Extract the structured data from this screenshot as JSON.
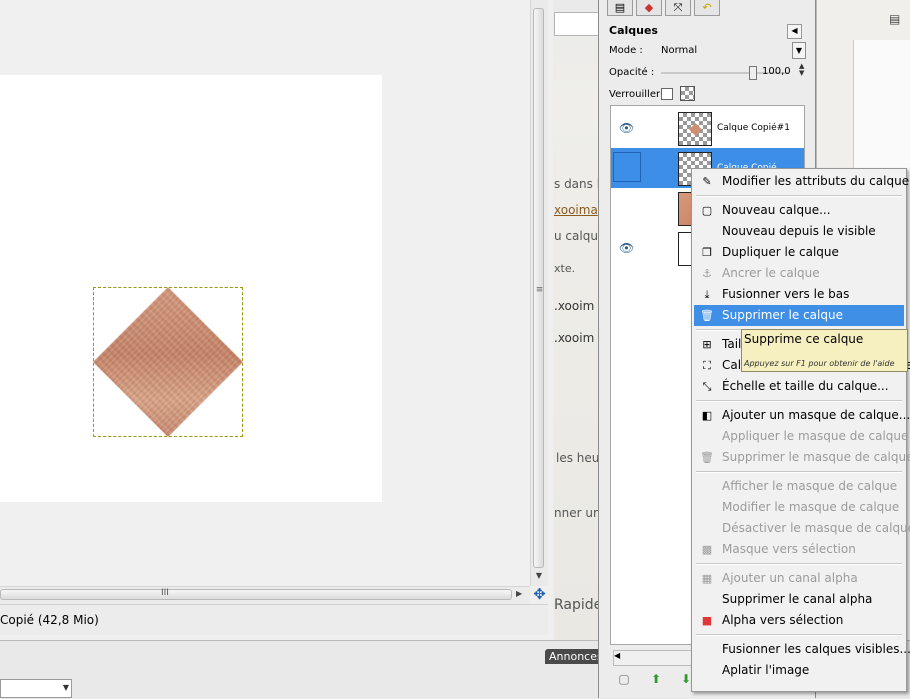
{
  "background_page": {
    "snippets": [
      "s dans l",
      "xooima",
      "u calque",
      "xte.",
      ".xooim",
      ".xooim",
      "les heu",
      "nner ur",
      "Rapide"
    ]
  },
  "image_window": {
    "status_text": "Copié (42,8 Mio)",
    "h_scroll_grip": "III",
    "v_scroll_grip": "≡"
  },
  "taskbar": {
    "annonces_label": "Annonces"
  },
  "layers_dock": {
    "title": "Calques",
    "mode_label": "Mode :",
    "mode_value": "Normal",
    "opacity_label": "Opacité :",
    "opacity_value": "100,0",
    "opacity_fraction": 1.0,
    "lock_label": "Verrouiller :",
    "layers": [
      {
        "name": "Calque Copié#1",
        "visible": true
      },
      {
        "name": "Calque Copié",
        "visible": false,
        "selected": true
      },
      {
        "name": "",
        "visible": false
      },
      {
        "name": "",
        "visible": true
      }
    ]
  },
  "context_menu": {
    "items": [
      {
        "label": "Modifier les attributs du calque...",
        "icon": "pencil-icon",
        "enabled": true
      },
      {
        "sep": true
      },
      {
        "label": "Nouveau calque...",
        "icon": "new-page-icon",
        "enabled": true
      },
      {
        "label": "Nouveau depuis le visible",
        "icon": "",
        "enabled": true
      },
      {
        "label": "Dupliquer le calque",
        "icon": "duplicate-icon",
        "enabled": true
      },
      {
        "label": "Ancrer le calque",
        "icon": "anchor-icon",
        "enabled": false
      },
      {
        "label": "Fusionner vers le bas",
        "icon": "merge-down-icon",
        "enabled": true
      },
      {
        "label": "Supprimer le calque",
        "icon": "trash-icon",
        "enabled": true,
        "highlight": true
      },
      {
        "sep": true
      },
      {
        "label": "Taille",
        "icon": "resize-icon",
        "enabled": true
      },
      {
        "label": "Calque aux dimensions de l'image",
        "icon": "fit-icon",
        "enabled": true
      },
      {
        "label": "Échelle et taille du calque...",
        "icon": "scale-icon",
        "enabled": true
      },
      {
        "sep": true
      },
      {
        "label": "Ajouter un masque de calque...",
        "icon": "add-mask-icon",
        "enabled": true
      },
      {
        "label": "Appliquer le masque de calque",
        "icon": "",
        "enabled": false
      },
      {
        "label": "Supprimer le masque de calque",
        "icon": "trash-icon",
        "enabled": false
      },
      {
        "sep": true
      },
      {
        "label": "Afficher le masque de calque",
        "icon": "",
        "enabled": false
      },
      {
        "label": "Modifier le masque de calque",
        "icon": "",
        "enabled": false
      },
      {
        "label": "Désactiver le masque de calque",
        "icon": "",
        "enabled": false
      },
      {
        "label": "Masque vers sélection",
        "icon": "mask-selection-icon",
        "enabled": false
      },
      {
        "sep": true
      },
      {
        "label": "Ajouter un canal alpha",
        "icon": "alpha-icon",
        "enabled": false
      },
      {
        "label": "Supprimer le canal alpha",
        "icon": "",
        "enabled": true
      },
      {
        "label": "Alpha vers sélection",
        "icon": "alpha-selection-icon",
        "enabled": true
      },
      {
        "sep": true
      },
      {
        "label": "Fusionner les calques visibles...",
        "icon": "",
        "enabled": true
      },
      {
        "label": "Aplatir l'image",
        "icon": "",
        "enabled": true
      }
    ]
  },
  "tooltip": {
    "title": "Supprime ce calque",
    "hint": "Appuyez sur F1 pour obtenir de l'aide"
  }
}
